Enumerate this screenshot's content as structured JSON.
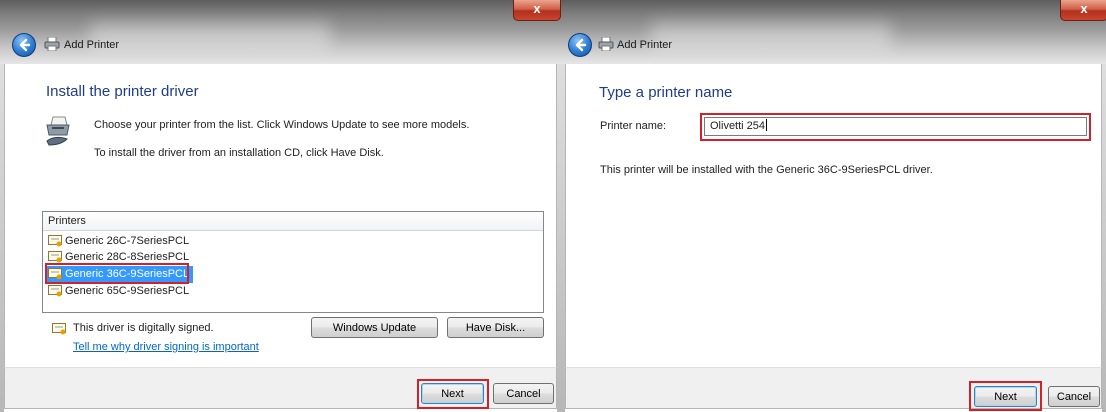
{
  "colors": {
    "heading": "#1e3c8a",
    "highlight": "#d4202b",
    "selection": "#3399ff",
    "link": "#0066cc"
  },
  "left_window": {
    "title": "Add Printer",
    "close_label": "x",
    "heading": "Install the printer driver",
    "instruction_1": "Choose your printer from the list. Click Windows Update to see more models.",
    "instruction_2": "To install the driver from an installation CD, click Have Disk.",
    "list_header": "Printers",
    "printers": [
      "Generic 26C-7SeriesPCL",
      "Generic 28C-8SeriesPCL",
      "Generic 36C-9SeriesPCL",
      "Generic 65C-9SeriesPCL"
    ],
    "selected_printer": "Generic 36C-9SeriesPCL",
    "signed_text": "This driver is digitally signed.",
    "signing_link": "Tell me why driver signing is important",
    "windows_update_label": "Windows Update",
    "have_disk_label": "Have Disk...",
    "next_label": "Next",
    "cancel_label": "Cancel"
  },
  "right_window": {
    "title": "Add Printer",
    "close_label": "x",
    "heading": "Type a printer name",
    "name_label": "Printer name:",
    "name_value": "Olivetti 254",
    "info_text": "This printer will be installed with the Generic 36C-9SeriesPCL driver.",
    "next_label": "Next",
    "cancel_label": "Cancel"
  },
  "icons": [
    "back-arrow-icon",
    "printer-icon",
    "close-icon",
    "driver-icon",
    "certificate-icon"
  ]
}
